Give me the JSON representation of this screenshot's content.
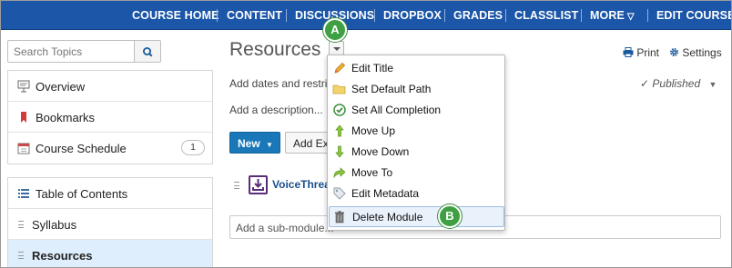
{
  "topnav": {
    "items": [
      "COURSE HOME",
      "CONTENT",
      "DISCUSSIONS",
      "DROPBOX",
      "GRADES",
      "CLASSLIST",
      "MORE",
      "EDIT COURSE"
    ]
  },
  "sidebar": {
    "search_placeholder": "Search Topics",
    "items": [
      {
        "label": "Overview"
      },
      {
        "label": "Bookmarks"
      },
      {
        "label": "Course Schedule",
        "badge": "1"
      },
      {
        "label": "Table of Contents"
      },
      {
        "label": "Syllabus"
      },
      {
        "label": "Resources"
      }
    ]
  },
  "main": {
    "title": "Resources",
    "print_label": "Print",
    "settings_label": "Settings",
    "add_dates_text": "Add dates and restric",
    "add_description_text": "Add a description...",
    "published_label": "Published",
    "new_button": "New",
    "add_button": "Add Ex",
    "topic_label": "VoiceThrea",
    "sub_module_placeholder": "Add a sub-module..."
  },
  "menu": {
    "items": [
      {
        "label": "Edit Title"
      },
      {
        "label": "Set Default Path"
      },
      {
        "label": "Set All Completion"
      },
      {
        "label": "Move Up"
      },
      {
        "label": "Move Down"
      },
      {
        "label": "Move To"
      },
      {
        "label": "Edit Metadata"
      },
      {
        "label": "Delete Module"
      }
    ]
  },
  "callouts": {
    "a": "A",
    "b": "B"
  },
  "colors": {
    "nav_bg": "#1b56a8",
    "primary_button": "#1a78b8",
    "callout_green": "#3ea043",
    "selected_row": "#dfeefc"
  }
}
